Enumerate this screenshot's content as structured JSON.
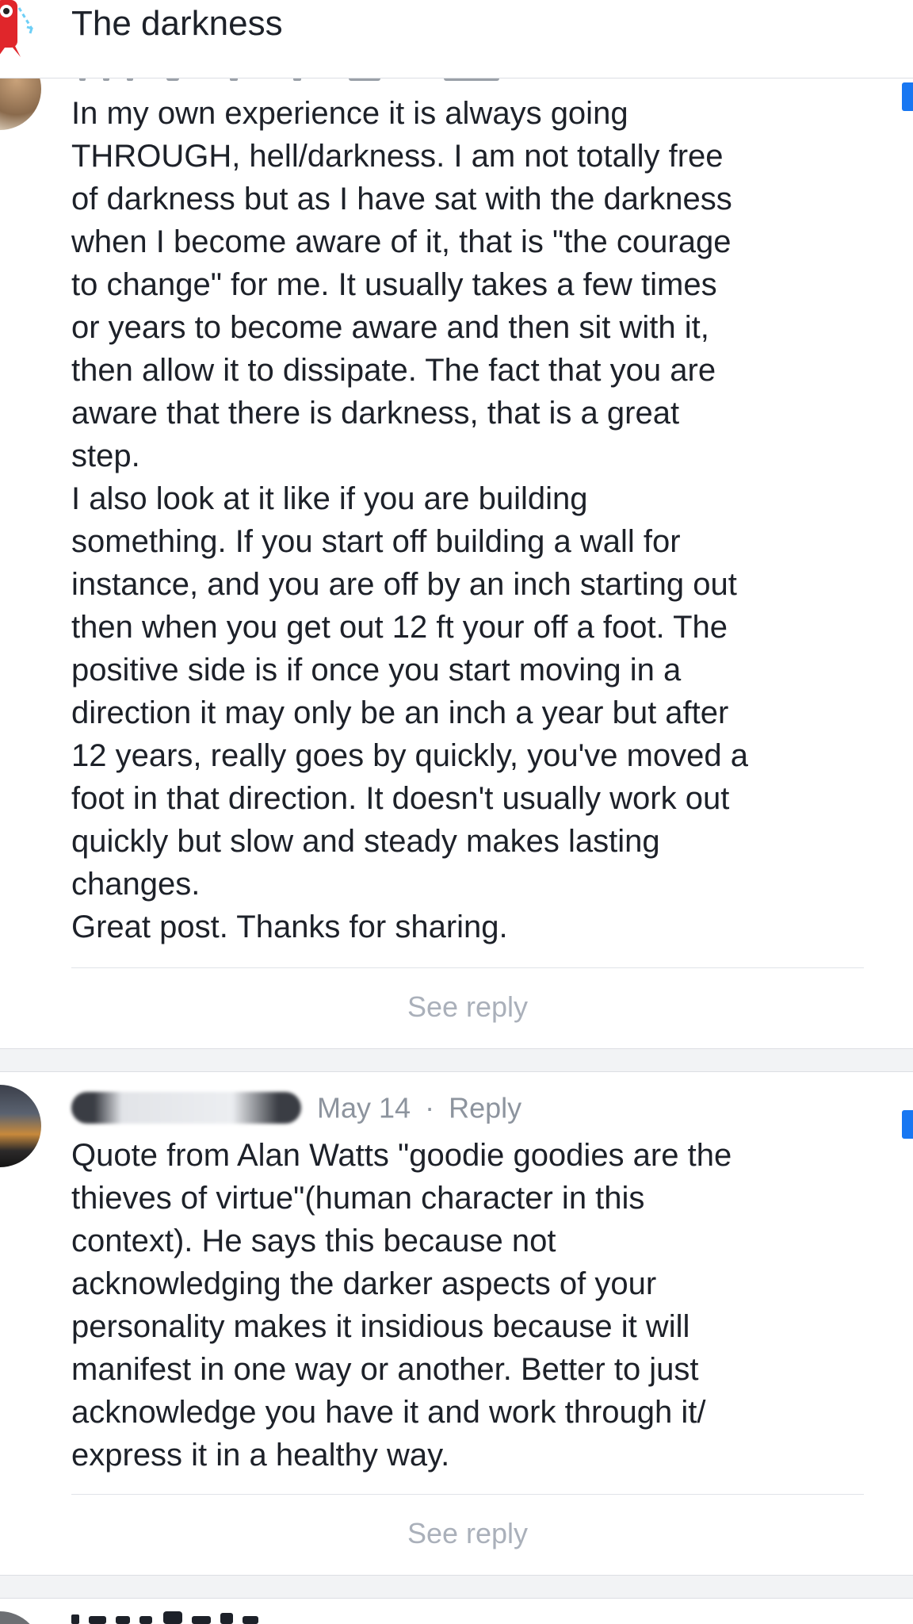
{
  "header": {
    "title": "The darkness"
  },
  "comments": [
    {
      "text": "In my own experience it is always going\nTHROUGH, hell/darkness.  I am not totally free\nof darkness but as I have sat with the darkness\nwhen I become aware of it, that is \"the courage\nto change\" for me. It usually takes a few times\nor years to become aware and then sit with it,\nthen allow it to dissipate.  The fact that you are\naware that there is darkness, that is a great\nstep.\nI also look at it like if you are building\nsomething. If you start off building a wall for\ninstance, and you are off by an inch starting out\nthen when you get out 12 ft your off a foot. The\npositive side is if once you start moving in a\ndirection it may only be an inch a year but after\n12 years, really goes by quickly, you've moved a\nfoot in that direction. It doesn't usually work out\nquickly but slow and steady makes lasting\nchanges.\nGreat post. Thanks for sharing.",
      "see_reply": "See reply"
    },
    {
      "date": "May 14",
      "separator": "·",
      "reply": "Reply",
      "text": "Quote from Alan Watts \"goodie goodies are the\nthieves of virtue\"(human character in this\ncontext). He says this because not\nacknowledging the darker aspects of your\npersonality makes it insidious because it will\nmanifest in one way or another. Better to just\nacknowledge you have it and work through it/\nexpress it in a healthy way.",
      "see_reply": "See reply"
    }
  ]
}
